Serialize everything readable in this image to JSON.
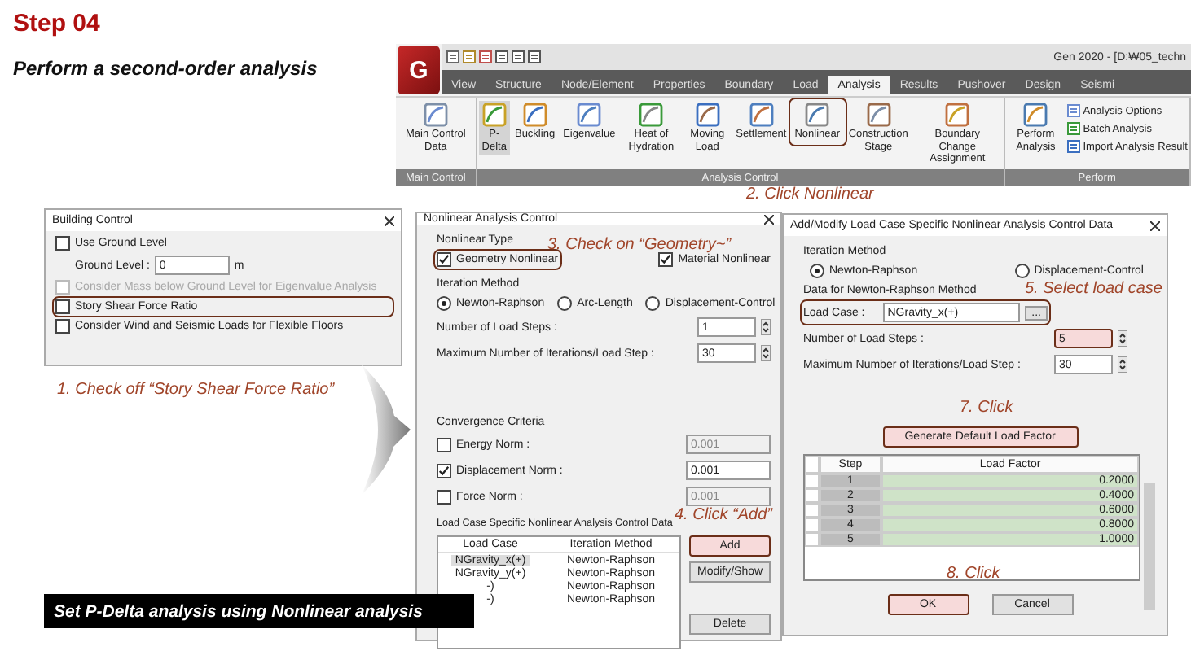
{
  "header": {
    "step": "Step 04",
    "subtitle": "Perform a second-order analysis"
  },
  "ribbon": {
    "logo": "G",
    "title": "Gen 2020 - [D:₩05_techn",
    "tabs": [
      {
        "label": "View",
        "selected": false
      },
      {
        "label": "Structure",
        "selected": false
      },
      {
        "label": "Node/Element",
        "selected": false
      },
      {
        "label": "Properties",
        "selected": false
      },
      {
        "label": "Boundary",
        "selected": false
      },
      {
        "label": "Load",
        "selected": false
      },
      {
        "label": "Analysis",
        "selected": true
      },
      {
        "label": "Results",
        "selected": false
      },
      {
        "label": "Pushover",
        "selected": false
      },
      {
        "label": "Design",
        "selected": false
      },
      {
        "label": "Seismi",
        "selected": false
      }
    ],
    "groups": [
      {
        "label": "Main Control",
        "tools": [
          {
            "label": "Main Control Data",
            "selected": false,
            "highlighted": false
          }
        ]
      },
      {
        "label": "Analysis Control",
        "tools": [
          {
            "label": "P-Delta",
            "selected": true,
            "highlighted": false
          },
          {
            "label": "Buckling",
            "selected": false,
            "highlighted": false
          },
          {
            "label": "Eigenvalue",
            "selected": false,
            "highlighted": false
          },
          {
            "label": "Heat of Hydration",
            "selected": false,
            "highlighted": false
          },
          {
            "label": "Moving Load",
            "selected": false,
            "highlighted": false
          },
          {
            "label": "Settlement",
            "selected": false,
            "highlighted": false
          },
          {
            "label": "Nonlinear",
            "selected": false,
            "highlighted": true
          },
          {
            "label": "Construction Stage",
            "selected": false,
            "highlighted": false
          },
          {
            "label": "Boundary Change Assignment",
            "selected": false,
            "highlighted": false
          }
        ]
      },
      {
        "label": "Perform",
        "tools": [
          {
            "label": "Perform Analysis",
            "selected": false,
            "highlighted": false
          }
        ],
        "links": [
          "Analysis Options",
          "Batch Analysis",
          "Import Analysis Result"
        ]
      }
    ],
    "callout": "2. Click Nonlinear"
  },
  "building_control": {
    "title": "Building Control",
    "options": [
      {
        "kind": "checkbox",
        "label": "Use Ground Level",
        "checked": false,
        "disabled": false,
        "highlighted": false
      },
      {
        "kind": "field",
        "label": "Ground Level :",
        "value": "0",
        "unit": "m"
      },
      {
        "kind": "checkbox",
        "label": "Consider Mass below Ground Level for Eigenvalue Analysis",
        "checked": false,
        "disabled": true,
        "highlighted": false
      },
      {
        "kind": "checkbox",
        "label": "Story Shear Force Ratio",
        "checked": false,
        "disabled": false,
        "highlighted": true
      },
      {
        "kind": "checkbox",
        "label": "Consider Wind and Seismic Loads for Flexible Floors",
        "checked": false,
        "disabled": false,
        "highlighted": false
      }
    ],
    "callout": "1. Check off “Story Shear Force Ratio”"
  },
  "nonlinear_dialog": {
    "title": "Nonlinear Analysis Control",
    "type_label": "Nonlinear Type",
    "types": [
      {
        "label": "Geometry Nonlinear",
        "checked": true,
        "highlighted": true
      },
      {
        "label": "Material Nonlinear",
        "checked": true,
        "highlighted": false
      }
    ],
    "iteration_label": "Iteration Method",
    "methods": [
      {
        "label": "Newton-Raphson",
        "selected": true
      },
      {
        "label": "Arc-Length",
        "selected": false
      },
      {
        "label": "Displacement-Control",
        "selected": false
      }
    ],
    "fields": [
      {
        "label": "Number of Load Steps :",
        "value": "1"
      },
      {
        "label": "Maximum Number of Iterations/Load Step :",
        "value": "30"
      }
    ],
    "convergence_label": "Convergence Criteria",
    "norms": [
      {
        "label": "Energy Norm :",
        "checked": false,
        "value": "0.001"
      },
      {
        "label": "Displacement Norm :",
        "checked": true,
        "value": "0.001"
      },
      {
        "label": "Force Norm :",
        "checked": false,
        "value": "0.001"
      }
    ],
    "table_label": "Load Case Specific Nonlinear Analysis Control Data",
    "columns": [
      "Load Case",
      "Iteration Method"
    ],
    "rows": [
      {
        "load_case": "NGravity_x(+)",
        "method": "Newton-Raphson",
        "selected": true
      },
      {
        "load_case": "NGravity_y(+)",
        "method": "Newton-Raphson",
        "selected": false
      },
      {
        "load_case": "-)",
        "method": "Newton-Raphson",
        "selected": false
      },
      {
        "load_case": "-)",
        "method": "Newton-Raphson",
        "selected": false
      }
    ],
    "buttons": [
      {
        "label": "Add",
        "highlighted": true
      },
      {
        "label": "Modify/Show",
        "highlighted": false
      },
      {
        "label": "Delete",
        "highlighted": false
      }
    ],
    "callouts": [
      "3. Check on “Geometry~”",
      "4. Click “Add”"
    ]
  },
  "add_dialog": {
    "title": "Add/Modify Load Case Specific Nonlinear Analysis Control Data",
    "iteration_label": "Iteration Method",
    "methods": [
      {
        "label": "Newton-Raphson",
        "selected": true
      },
      {
        "label": "Displacement-Control",
        "selected": false
      }
    ],
    "data_label": "Data for Newton-Raphson Method",
    "load_case": {
      "label": "Load Case :",
      "value": "NGravity_x(+)",
      "more": "...",
      "highlighted": true
    },
    "fields": [
      {
        "label": "Number of Load Steps :",
        "value": "5",
        "highlighted": true
      },
      {
        "label": "Maximum Number of Iterations/Load Step :",
        "value": "30",
        "highlighted": false
      }
    ],
    "generate": {
      "label": "Generate Default Load Factor",
      "highlighted": true
    },
    "columns": [
      "Step",
      "Load Factor"
    ],
    "rows": [
      {
        "step": "1",
        "factor": "0.2000"
      },
      {
        "step": "2",
        "factor": "0.4000"
      },
      {
        "step": "3",
        "factor": "0.6000"
      },
      {
        "step": "4",
        "factor": "0.8000"
      },
      {
        "step": "5",
        "factor": "1.0000"
      }
    ],
    "buttons": [
      {
        "label": "OK",
        "highlighted": true
      },
      {
        "label": "Cancel",
        "highlighted": false
      }
    ],
    "callouts": [
      "5. Select load case",
      "7. Click",
      "8. Click"
    ]
  },
  "banner": "Set P-Delta analysis using Nonlinear analysis"
}
